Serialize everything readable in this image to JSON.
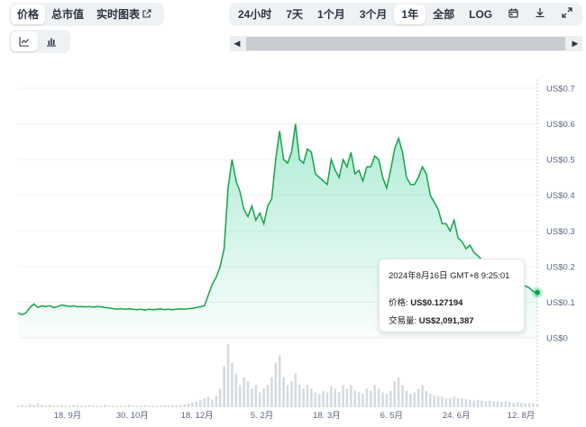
{
  "toolbar": {
    "metric_tabs": [
      "价格",
      "总市值",
      "实时图表"
    ],
    "range_tabs": [
      "24小时",
      "7天",
      "1个月",
      "3个月",
      "1年",
      "全部",
      "LOG"
    ],
    "active_metric": "价格",
    "active_range": "1年",
    "icons": [
      "external-link-icon",
      "calendar-icon",
      "download-icon",
      "expand-icon",
      "line-chart-icon",
      "candlestick-chart-icon"
    ]
  },
  "tooltip": {
    "date": "2024年8月16日 GMT+8 9:25:01",
    "price_label": "价格:",
    "price_value": "US$0.127194",
    "volume_label": "交易量:",
    "volume_value": "US$2,091,387"
  },
  "colors": {
    "line": "#16a34a",
    "fill": "#16c784",
    "volume": "#d6dbe0",
    "grid": "#eef0f3"
  },
  "chart_data": {
    "type": "line",
    "x_tick_labels": [
      "18. 9月",
      "30. 10月",
      "18. 12月",
      "5. 2月",
      "18. 3月",
      "6. 5月",
      "24. 6月",
      "12. 8月"
    ],
    "y_tick_labels": [
      "US$0",
      "US$0.1",
      "US$0.2",
      "US$0.3",
      "US$0.4",
      "US$0.5",
      "US$0.6",
      "US$0.7"
    ],
    "ylim": [
      0,
      0.7
    ],
    "grid": true,
    "series": [
      {
        "values": [
          0.07,
          0.065,
          0.07,
          0.085,
          0.095,
          0.085,
          0.09,
          0.088,
          0.09,
          0.085,
          0.088,
          0.092,
          0.09,
          0.088,
          0.09,
          0.087,
          0.088,
          0.087,
          0.088,
          0.086,
          0.088,
          0.087,
          0.085,
          0.084,
          0.082,
          0.08,
          0.082,
          0.08,
          0.081,
          0.08,
          0.079,
          0.08,
          0.078,
          0.08,
          0.079,
          0.08,
          0.081,
          0.079,
          0.08,
          0.079,
          0.08,
          0.081,
          0.08,
          0.082,
          0.083,
          0.085,
          0.087,
          0.09,
          0.12,
          0.15,
          0.17,
          0.2,
          0.25,
          0.42,
          0.5,
          0.44,
          0.41,
          0.36,
          0.34,
          0.37,
          0.33,
          0.35,
          0.32,
          0.37,
          0.39,
          0.5,
          0.58,
          0.5,
          0.49,
          0.52,
          0.6,
          0.5,
          0.49,
          0.53,
          0.52,
          0.46,
          0.45,
          0.44,
          0.43,
          0.5,
          0.47,
          0.45,
          0.5,
          0.48,
          0.52,
          0.46,
          0.47,
          0.44,
          0.48,
          0.48,
          0.51,
          0.5,
          0.45,
          0.42,
          0.47,
          0.53,
          0.56,
          0.52,
          0.45,
          0.43,
          0.43,
          0.45,
          0.48,
          0.46,
          0.4,
          0.38,
          0.36,
          0.32,
          0.32,
          0.3,
          0.33,
          0.28,
          0.27,
          0.25,
          0.26,
          0.24,
          0.23,
          0.22,
          0.21,
          0.2,
          0.2,
          0.18,
          0.17,
          0.17,
          0.165,
          0.155,
          0.15,
          0.15,
          0.145,
          0.14,
          0.13,
          0.127
        ]
      }
    ],
    "volume": [
      0.02,
      0.03,
      0.02,
      0.04,
      0.03,
      0.05,
      0.03,
      0.02,
      0.03,
      0.02,
      0.02,
      0.03,
      0.02,
      0.02,
      0.03,
      0.02,
      0.02,
      0.02,
      0.03,
      0.02,
      0.02,
      0.02,
      0.03,
      0.02,
      0.02,
      0.02,
      0.02,
      0.02,
      0.03,
      0.02,
      0.02,
      0.02,
      0.03,
      0.02,
      0.02,
      0.02,
      0.02,
      0.03,
      0.02,
      0.03,
      0.02,
      0.03,
      0.04,
      0.05,
      0.06,
      0.08,
      0.1,
      0.12,
      0.14,
      0.1,
      0.15,
      0.25,
      0.55,
      0.85,
      0.6,
      0.45,
      0.3,
      0.4,
      0.35,
      0.25,
      0.3,
      0.2,
      0.25,
      0.3,
      0.4,
      0.6,
      0.7,
      0.4,
      0.3,
      0.35,
      0.45,
      0.3,
      0.25,
      0.3,
      0.25,
      0.2,
      0.18,
      0.22,
      0.2,
      0.28,
      0.25,
      0.2,
      0.3,
      0.25,
      0.3,
      0.22,
      0.2,
      0.18,
      0.25,
      0.22,
      0.3,
      0.25,
      0.2,
      0.18,
      0.22,
      0.35,
      0.4,
      0.3,
      0.22,
      0.18,
      0.2,
      0.25,
      0.3,
      0.22,
      0.18,
      0.16,
      0.15,
      0.14,
      0.12,
      0.12,
      0.14,
      0.13,
      0.12,
      0.11,
      0.1,
      0.09,
      0.1,
      0.09,
      0.08,
      0.09,
      0.08,
      0.08,
      0.07,
      0.08,
      0.07,
      0.06,
      0.07,
      0.06,
      0.05,
      0.06,
      0.05,
      0.04
    ]
  }
}
